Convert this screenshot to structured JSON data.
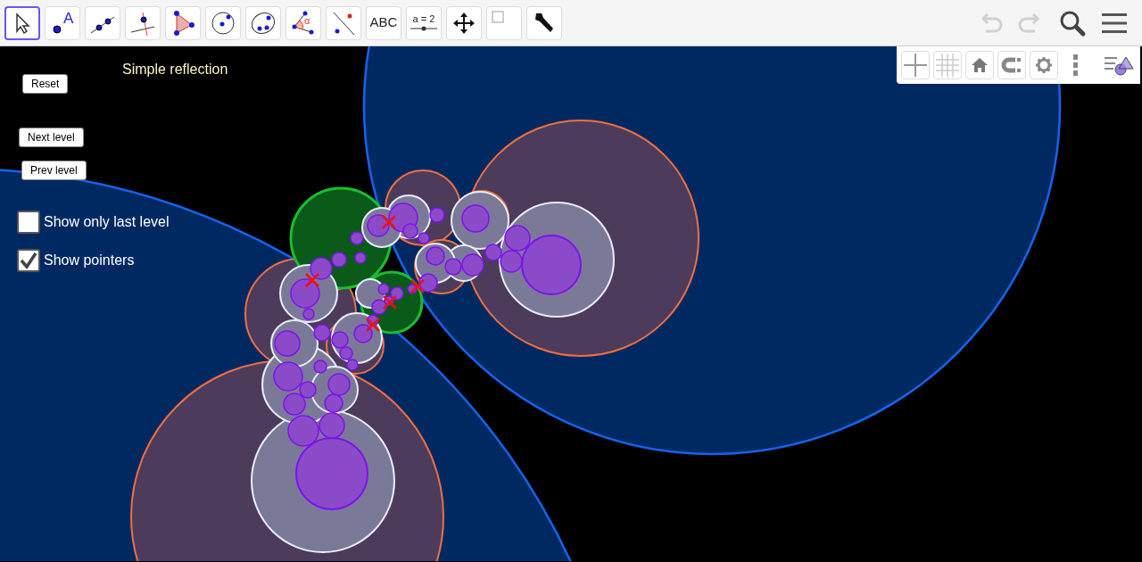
{
  "toolbar": {
    "tools": [
      {
        "kind": "move",
        "selected": true
      },
      {
        "kind": "point",
        "selected": false,
        "label": "A"
      },
      {
        "kind": "line",
        "selected": false
      },
      {
        "kind": "perpendicular",
        "selected": false
      },
      {
        "kind": "polygon",
        "selected": false
      },
      {
        "kind": "circle",
        "selected": false
      },
      {
        "kind": "conic",
        "selected": false
      },
      {
        "kind": "angle",
        "selected": false,
        "label": "α"
      },
      {
        "kind": "reflect",
        "selected": false
      },
      {
        "kind": "text",
        "selected": false,
        "label": "ABC"
      },
      {
        "kind": "slider",
        "selected": false,
        "label": "a = 2"
      },
      {
        "kind": "pan",
        "selected": false
      },
      {
        "kind": "checkbox",
        "selected": false
      },
      {
        "kind": "tools",
        "selected": false
      }
    ],
    "undo": {
      "disabled": true
    },
    "redo": {
      "disabled": true
    }
  },
  "canvas": {
    "title": "Simple reflection",
    "buttons": [
      "Reset",
      "Next level",
      "Prev level"
    ],
    "checkboxes": [
      {
        "label": "Show only last level",
        "checked": false
      },
      {
        "label": "Show pointers",
        "checked": true
      }
    ]
  }
}
